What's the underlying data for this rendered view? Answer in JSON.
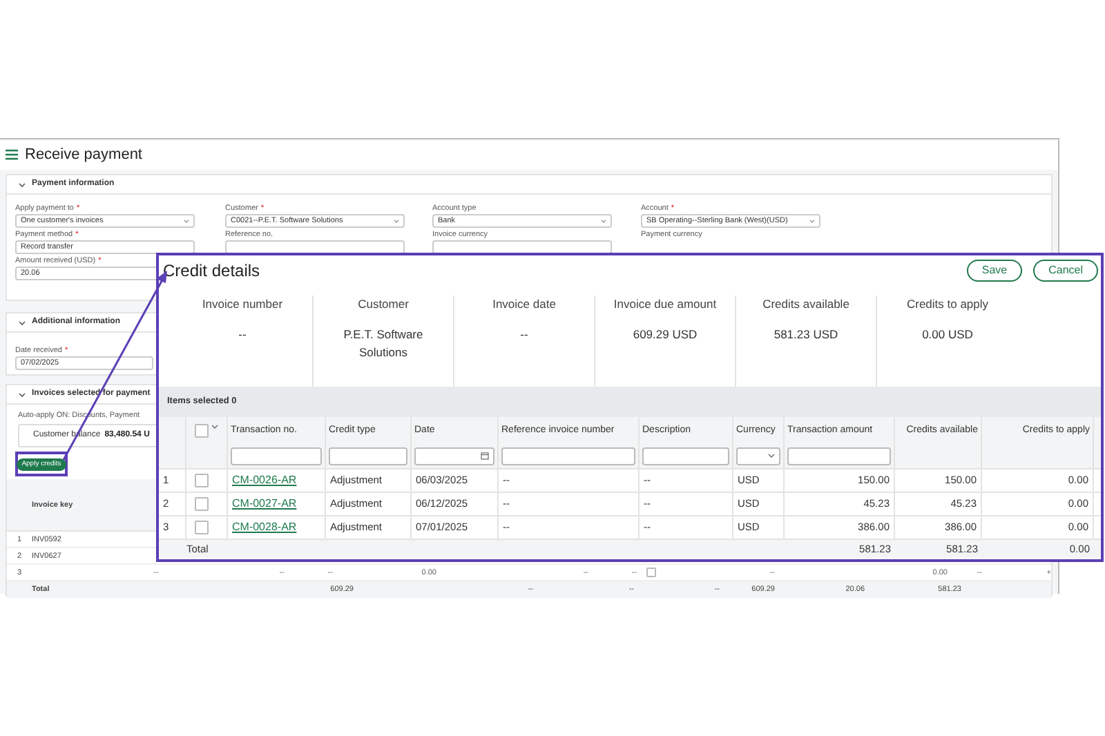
{
  "page": {
    "title": "Receive payment"
  },
  "required_marker": "*",
  "payment_information": {
    "heading": "Payment information",
    "expanded": true,
    "fields": [
      {
        "label": "Apply payment to",
        "required": true,
        "kind": "select",
        "value": "One customer's invoices"
      },
      {
        "label": "Customer",
        "required": true,
        "kind": "select",
        "value": "C0021--P.E.T. Software Solutions"
      },
      {
        "label": "Account type",
        "required": false,
        "kind": "select",
        "value": "Bank"
      },
      {
        "label": "Account",
        "required": true,
        "kind": "select",
        "value": "SB Operating--Sterling Bank (West)(USD)"
      },
      {
        "label": "Payment method",
        "required": true,
        "kind": "text",
        "value": "Record transfer"
      },
      {
        "label": "Reference no.",
        "required": false,
        "kind": "text"
      },
      {
        "label": "Invoice currency",
        "required": false,
        "kind": "text"
      },
      {
        "label": "Payment currency",
        "required": false,
        "kind": "plain"
      },
      {
        "label": "Amount received (USD)",
        "required": true,
        "kind": "text",
        "value": "20.06"
      }
    ]
  },
  "additional_information": {
    "heading": "Additional information",
    "expanded": true,
    "field": {
      "label": "Date received",
      "required": true,
      "value": "07/02/2025"
    }
  },
  "invoices": {
    "heading": "Invoices selected for payment",
    "expanded": true,
    "auto_apply": "Auto-apply ON: Discounts, Payment",
    "balance_label": "Customer balance",
    "balance_value": "83,480.54 U",
    "apply_button": "Apply credits",
    "key_column": "Invoice key",
    "rows": [
      {
        "index": "1",
        "key": "INV0592"
      },
      {
        "index": "2",
        "key": "INV0627"
      },
      {
        "index": "3",
        "cells": [
          {
            "kind": "text",
            "text": "--"
          },
          {
            "kind": "text",
            "text": "--"
          },
          {
            "kind": "text",
            "text": "--"
          },
          {
            "kind": "text",
            "text": "0.00"
          },
          {
            "kind": "text",
            "text": "--"
          },
          {
            "kind": "text",
            "text": "--"
          },
          {
            "kind": "checkbox",
            "checked": false
          },
          {
            "kind": "text",
            "text": "--"
          },
          {
            "kind": "text",
            "text": "0.00"
          },
          {
            "kind": "text",
            "text": "--"
          },
          {
            "kind": "text",
            "text": "+"
          }
        ]
      }
    ],
    "total": {
      "label": "Total",
      "values": [
        "609.29",
        "--",
        "--",
        "--",
        "609.29",
        "20.06",
        "581.23"
      ]
    }
  },
  "credit_details": {
    "title": "Credit details",
    "buttons": [
      "Save",
      "Cancel"
    ],
    "summary": [
      {
        "label": "Invoice number",
        "value": "--"
      },
      {
        "label": "Customer",
        "value": "P.E.T. Software Solutions"
      },
      {
        "label": "Invoice date",
        "value": "--"
      },
      {
        "label": "Invoice due amount",
        "value": "609.29 USD"
      },
      {
        "label": "Credits available",
        "value": "581.23 USD"
      },
      {
        "label": "Credits to apply",
        "value": "0.00 USD"
      }
    ],
    "items_selected": "Items selected 0",
    "all_checked": false,
    "columns": [
      {
        "label": "Transaction no.",
        "kind": "text"
      },
      {
        "label": "Credit type",
        "kind": "text"
      },
      {
        "label": "Date",
        "kind": "date"
      },
      {
        "label": "Reference invoice number",
        "kind": "text"
      },
      {
        "label": "Description",
        "kind": "text"
      },
      {
        "label": "Currency",
        "kind": "select"
      },
      {
        "label": "Transaction amount",
        "kind": "text"
      },
      {
        "label": "Credits available",
        "kind": "plain"
      },
      {
        "label": "Credits to apply",
        "kind": "plain"
      }
    ],
    "rows": [
      {
        "index": "1",
        "checked": false,
        "transaction_no": "CM-0026-AR",
        "credit_type": "Adjustment",
        "date": "06/03/2025",
        "reference": "--",
        "description": "--",
        "currency": "USD",
        "amount": "150.00",
        "available": "150.00",
        "to_apply": "0.00"
      },
      {
        "index": "2",
        "checked": false,
        "transaction_no": "CM-0027-AR",
        "credit_type": "Adjustment",
        "date": "06/12/2025",
        "reference": "--",
        "description": "--",
        "currency": "USD",
        "amount": "45.23",
        "available": "45.23",
        "to_apply": "0.00"
      },
      {
        "index": "3",
        "checked": false,
        "transaction_no": "CM-0028-AR",
        "credit_type": "Adjustment",
        "date": "07/01/2025",
        "reference": "--",
        "description": "--",
        "currency": "USD",
        "amount": "386.00",
        "available": "386.00",
        "to_apply": "0.00"
      }
    ],
    "total": {
      "label": "Total",
      "amount": "581.23",
      "available": "581.23",
      "to_apply": "0.00"
    }
  }
}
